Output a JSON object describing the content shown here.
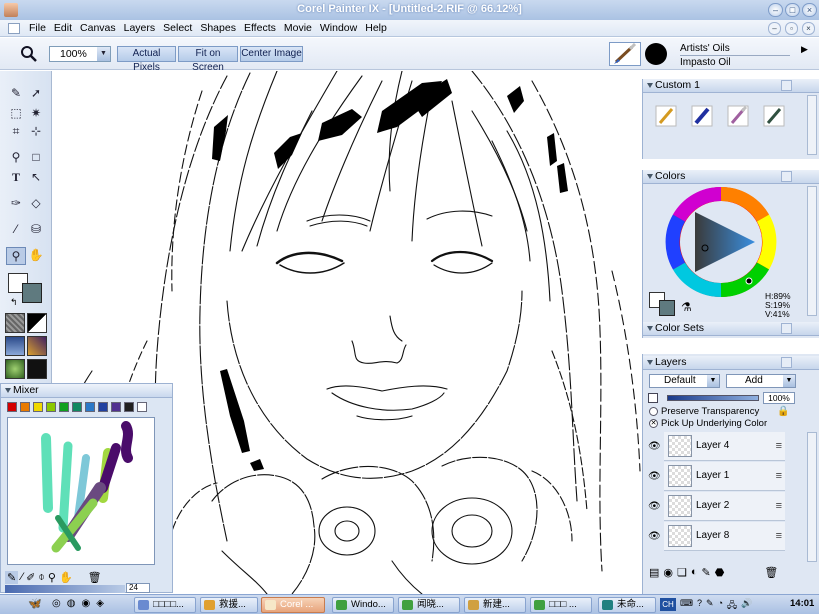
{
  "window": {
    "title": "Corel Painter IX - [Untitled-2.RIF @ 66.12%]"
  },
  "menu": [
    "File",
    "Edit",
    "Canvas",
    "Layers",
    "Select",
    "Shapes",
    "Effects",
    "Movie",
    "Window",
    "Help"
  ],
  "toolbar": {
    "zoom_value": "100%",
    "actual_pixels": "Actual Pixels",
    "fit_on_screen": "Fit on Screen",
    "center_image": "Center Image",
    "brush_category": "Artists' Oils",
    "brush_variant": "Impasto Oil"
  },
  "custom_palette": {
    "title": "Custom  1",
    "brushes": [
      "pencil-brush",
      "ink-brush",
      "oil-brush",
      "pen-brush"
    ]
  },
  "colors_palette": {
    "title": "Colors",
    "hsv_h": "H:89%",
    "hsv_s": "S:19%",
    "hsv_v": "V:41%",
    "main_color": "#5f7a7f"
  },
  "color_sets": {
    "title": "Color Sets"
  },
  "layers_palette": {
    "title": "Layers",
    "composite_method": "Default",
    "composite_depth": "Add",
    "opacity": "100%",
    "preserve_transparency": "Preserve Transparency",
    "pick_up_underlying": "Pick Up Underlying Color",
    "layers": [
      "Layer 4",
      "Layer 1",
      "Layer 2",
      "Layer 8"
    ]
  },
  "mixer": {
    "title": "Mixer",
    "swatches": [
      "#d40000",
      "#e87a00",
      "#f0d800",
      "#8cc800",
      "#10a020",
      "#108860",
      "#2a78c8",
      "#2040a0",
      "#503090",
      "#202020",
      "#ffffff"
    ],
    "brush_size": "24"
  },
  "taskbar": {
    "items": [
      "□□□□...",
      "救援...",
      "Corel ...",
      "Windo...",
      "闻晓...",
      "新建...",
      "□□□ ...",
      "未命..."
    ],
    "lang": "CH",
    "clock": "14:01"
  }
}
